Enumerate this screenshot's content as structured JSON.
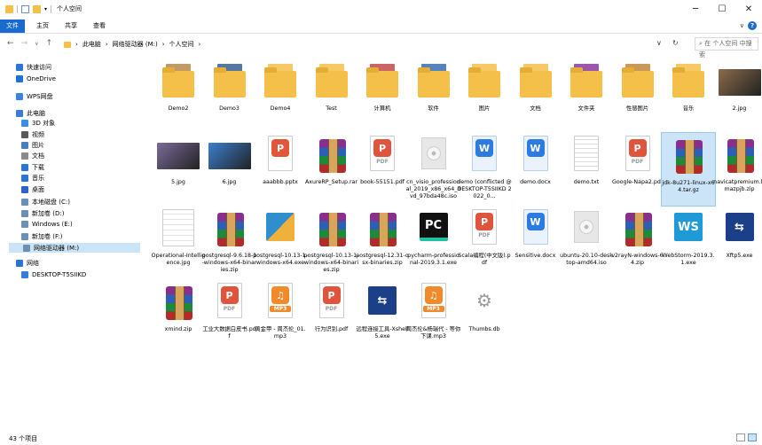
{
  "window": {
    "title": "个人空间",
    "controls": [
      "minimize",
      "maximize",
      "close"
    ]
  },
  "ribbon": {
    "tabs": [
      "文件",
      "主页",
      "共享",
      "查看"
    ]
  },
  "address": {
    "path": [
      "此电脑",
      "网络驱动器 (M:)",
      "个人空间"
    ],
    "search_placeholder": "在 个人空间 中搜索"
  },
  "sidebar": {
    "items": [
      {
        "label": "快速访问",
        "icon": "star-icon",
        "color": "#2b78d4"
      },
      {
        "label": "OneDrive",
        "icon": "cloud-icon",
        "color": "#1e74d6"
      },
      {
        "label": "WPS网盘",
        "icon": "cloud-icon",
        "color": "#3a83e0"
      },
      {
        "label": "此电脑",
        "icon": "computer-icon",
        "color": "#3a7bd5"
      },
      {
        "label": "3D 对象",
        "icon": "cube-icon",
        "color": "#3a8ee6"
      },
      {
        "label": "视频",
        "icon": "video-icon",
        "color": "#5a5a5a"
      },
      {
        "label": "图片",
        "icon": "picture-icon",
        "color": "#4a7fbf"
      },
      {
        "label": "文档",
        "icon": "document-icon",
        "color": "#8a8a8a"
      },
      {
        "label": "下载",
        "icon": "download-icon",
        "color": "#2a74d6"
      },
      {
        "label": "音乐",
        "icon": "music-icon",
        "color": "#2a74d6"
      },
      {
        "label": "桌面",
        "icon": "desktop-icon",
        "color": "#2a64c6"
      },
      {
        "label": "本地磁盘 (C:)",
        "icon": "drive-icon",
        "color": "#6b8fb5"
      },
      {
        "label": "新加卷 (D:)",
        "icon": "drive-icon",
        "color": "#6b8fb5"
      },
      {
        "label": "Windows (E:)",
        "icon": "drive-icon",
        "color": "#6b8fb5"
      },
      {
        "label": "新加卷 (F:)",
        "icon": "drive-icon",
        "color": "#6b8fb5"
      },
      {
        "label": "网络驱动器 (M:)",
        "icon": "network-drive-icon",
        "color": "#6b8fb5"
      },
      {
        "label": "网络",
        "icon": "network-icon",
        "color": "#2a74d6"
      },
      {
        "label": "DESKTOP-T5SIIKD",
        "icon": "computer-icon",
        "color": "#3a7bd5"
      }
    ]
  },
  "files": [
    {
      "name": "Demo2",
      "kind": "folder",
      "accent": "#b58a4a"
    },
    {
      "name": "Demo3",
      "kind": "folder",
      "accent": "#3a5f8f"
    },
    {
      "name": "Demo4",
      "kind": "folder",
      "accent": "#f5c04a"
    },
    {
      "name": "Test",
      "kind": "folder",
      "accent": "#f5c04a"
    },
    {
      "name": "计算机",
      "kind": "folder",
      "accent": "#c24a4a"
    },
    {
      "name": "软件",
      "kind": "folder",
      "accent": "#3a6fb0"
    },
    {
      "name": "图片",
      "kind": "folder",
      "accent": "#f5c04a"
    },
    {
      "name": "文档",
      "kind": "folder",
      "accent": "#f5c04a"
    },
    {
      "name": "文件夹",
      "kind": "folder",
      "accent": "#8a3a9a"
    },
    {
      "name": "性感图片",
      "kind": "folder",
      "accent": "#c2873a"
    },
    {
      "name": "音乐",
      "kind": "folder",
      "accent": "#f5c04a"
    },
    {
      "name": "2.jpg",
      "kind": "photo",
      "accent": "#8b6b4a"
    },
    {
      "name": "5.jpg",
      "kind": "photo",
      "accent": "#7a6a9a"
    },
    {
      "name": "6.jpg",
      "kind": "photo",
      "accent": "#3a7fd0"
    },
    {
      "name": "aaabbb.pptx",
      "kind": "ppt",
      "accent": "#e2573b"
    },
    {
      "name": "AxureRP_Setup.rar",
      "kind": "rar"
    },
    {
      "name": "book-55151.pdf",
      "kind": "pdf",
      "accent": "#e0533d"
    },
    {
      "name": "cn_visio_professional_2019_x86_x64_dvd_97bda48c.iso",
      "kind": "iso"
    },
    {
      "name": "demo (conflicted @DESKTOP-T5SIIKD 2022_0...",
      "kind": "word",
      "accent": "#2b7be3"
    },
    {
      "name": "demo.docx",
      "kind": "word",
      "accent": "#2b7be3"
    },
    {
      "name": "demo.txt",
      "kind": "text"
    },
    {
      "name": "Google-Napa2.pdf",
      "kind": "pdf",
      "accent": "#e0533d"
    },
    {
      "name": "jdk-8u271-linux-x64.tar.gz",
      "kind": "rar",
      "selected": true
    },
    {
      "name": "navicatpremium.lsmazpjb.zip",
      "kind": "rar"
    },
    {
      "name": "Operational-Intelligence.jpg",
      "kind": "photo",
      "accent": "#d8d8e8"
    },
    {
      "name": "postgresql-9.6.18-1-windows-x64-binaries.zip",
      "kind": "rar"
    },
    {
      "name": "postgresql-10.13-1-windows-x64.exe",
      "kind": "exe-pkg",
      "accent": "#2f8fce"
    },
    {
      "name": "postgresql-10.13-1-windows-x64-binaries.zip",
      "kind": "rar"
    },
    {
      "name": "postgresql-12.31-osx-binaries.zip",
      "kind": "rar"
    },
    {
      "name": "pycharm-professional-2019.3.1.exe",
      "kind": "exe",
      "accent": "#20c3a0",
      "text": "PC"
    },
    {
      "name": "Scala编程(中文版).pdf",
      "kind": "pdf",
      "accent": "#e0533d"
    },
    {
      "name": "Sensitive.docx",
      "kind": "word",
      "accent": "#2b7be3"
    },
    {
      "name": "ubuntu-20.10-desktop-amd64.iso",
      "kind": "iso"
    },
    {
      "name": "v2rayN-windows-64.zip",
      "kind": "rar"
    },
    {
      "name": "WebStorm-2019.3.1.exe",
      "kind": "exe",
      "accent": "#1f9ad6",
      "text": "WS"
    },
    {
      "name": "Xftp5.exe",
      "kind": "exe",
      "accent": "#1c3f8a",
      "text": "⇆"
    },
    {
      "name": "xmind.zip",
      "kind": "rar"
    },
    {
      "name": "工业大数据白皮书.pdf",
      "kind": "pdf",
      "accent": "#e0533d"
    },
    {
      "name": "黄金甲 - 周杰伦_01.mp3",
      "kind": "mp3",
      "accent": "#f08a2a"
    },
    {
      "name": "行为识别.pdf",
      "kind": "pdf",
      "accent": "#e0533d"
    },
    {
      "name": "远程连接工具-Xshell5.exe",
      "kind": "exe",
      "accent": "#1c3f8a",
      "text": "⇆"
    },
    {
      "name": "周杰伦&杨瑞代 - 等你下课.mp3",
      "kind": "mp3",
      "accent": "#f08a2a"
    },
    {
      "name": "Thumbs.db",
      "kind": "db"
    }
  ],
  "labels": {
    "pdf": "PDF",
    "mp3": "MP3"
  },
  "status": {
    "count": "43 个项目"
  }
}
